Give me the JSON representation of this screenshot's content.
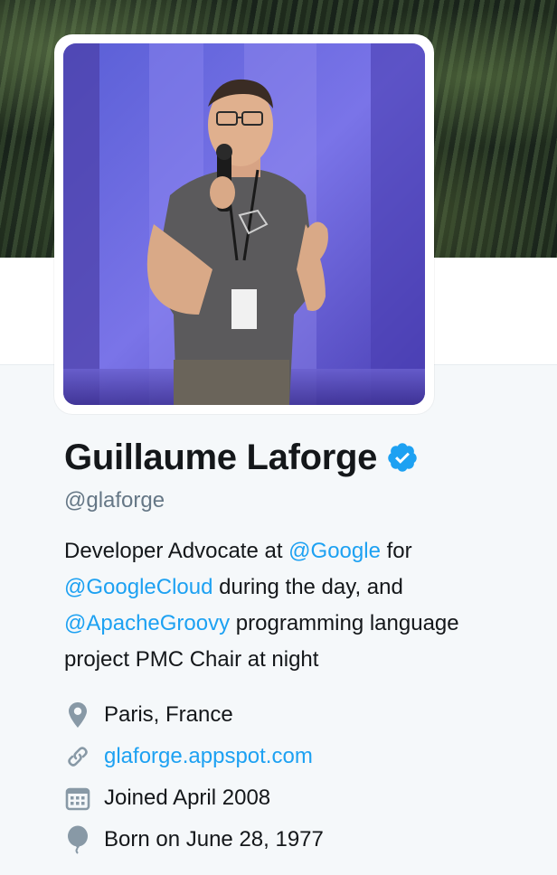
{
  "profile": {
    "name": "Guillaume Laforge",
    "handle": "@glaforge",
    "verified": true
  },
  "bio": {
    "line1_prefix": "Developer Advocate at ",
    "mention_google": "@Google",
    "line1_suffix": " for",
    "mention_googlecloud": "@GoogleCloud",
    "line2_suffix": " during the day, and",
    "mention_apachegroovy": "@ApacheGroovy",
    "line3_suffix": " programming language",
    "line4": "project PMC Chair at night"
  },
  "meta": {
    "location": "Paris, France",
    "website": "glaforge.appspot.com",
    "joined": "Joined April 2008",
    "birthday": "Born on June 28, 1977"
  },
  "icons": {
    "location": "location-pin-icon",
    "website": "link-icon",
    "joined": "calendar-icon",
    "birthday": "balloon-icon",
    "verified": "verified-badge-icon"
  },
  "colors": {
    "link": "#1da1f2",
    "text": "#14171a",
    "secondary": "#657786",
    "icon": "#8899a6",
    "background": "#f5f8fa"
  }
}
